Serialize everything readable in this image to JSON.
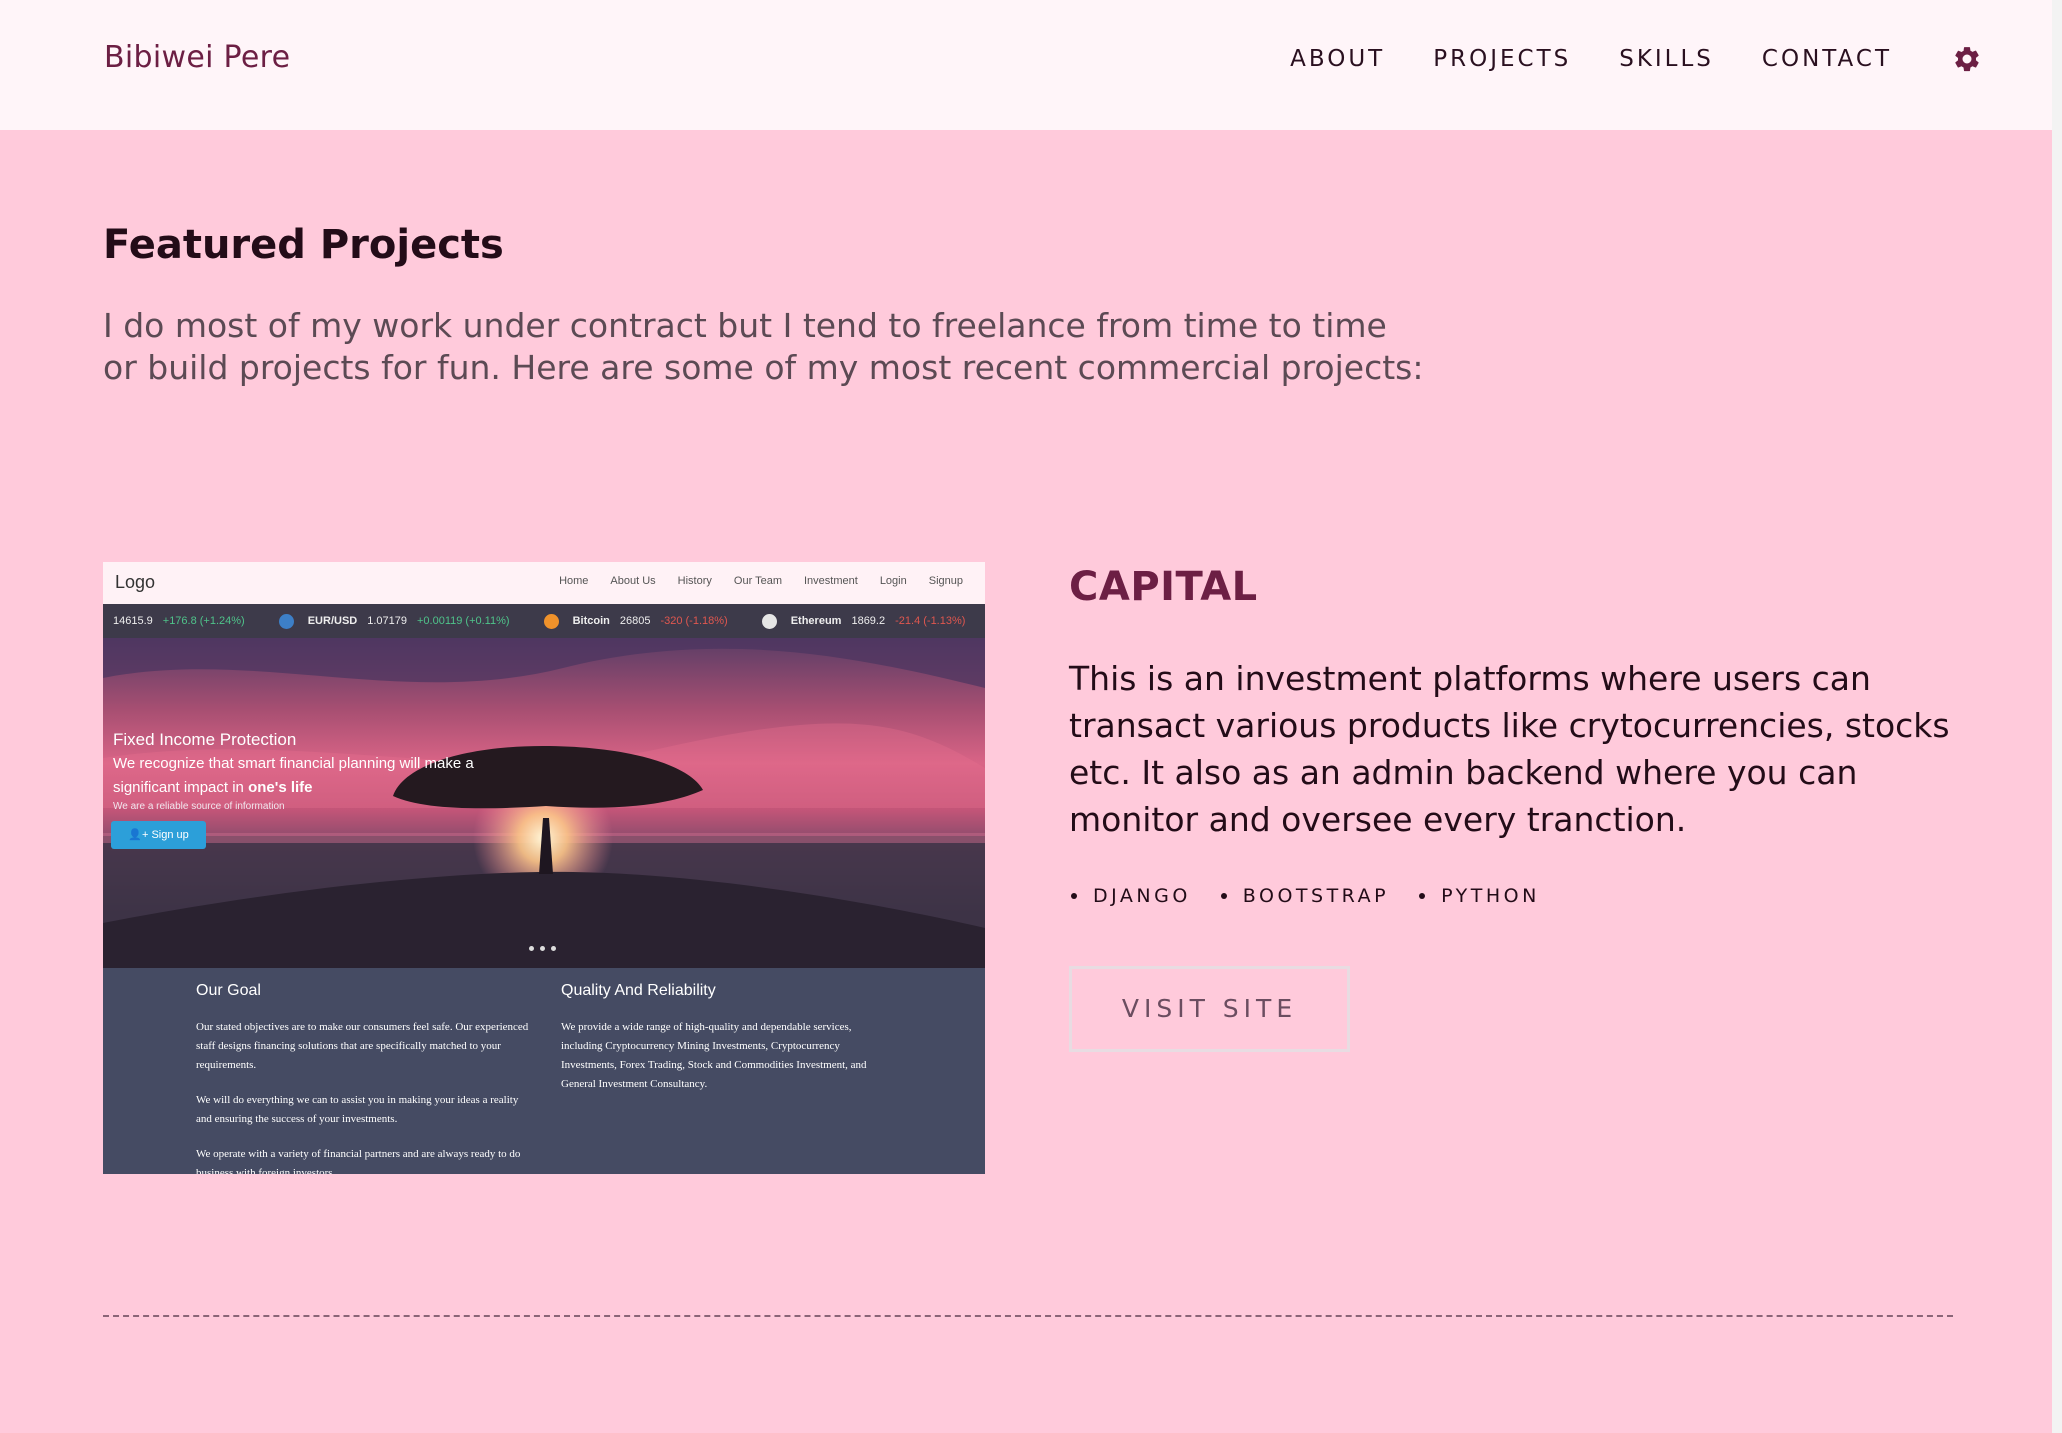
{
  "nav": {
    "brand": "Bibiwei Pere",
    "links": [
      {
        "label": "ABOUT"
      },
      {
        "label": "PROJECTS"
      },
      {
        "label": "SKILLS"
      },
      {
        "label": "CONTACT"
      }
    ],
    "settings_icon": "gear-icon"
  },
  "featured": {
    "heading": "Featured Projects",
    "intro_line1": "I do most of my work under contract but I tend to freelance from time to time",
    "intro_line2": "or build projects for fun. Here are some of my most recent commercial projects:"
  },
  "project": {
    "title": "CAPITAL",
    "description": "This is an investment platforms where users can transact various products like crytocurrencies, stocks etc. It also as an admin backend where you can monitor and oversee every tranction.",
    "tags": [
      "DJANGO",
      "BOOTSTRAP",
      "PYTHON"
    ],
    "visit_label": "VISIT SITE",
    "screenshot": {
      "logo": "Logo",
      "nav_links": [
        "Home",
        "About Us",
        "History",
        "Our Team",
        "Investment",
        "Login",
        "Signup"
      ],
      "ticker": [
        {
          "name": "",
          "price": "14615.9",
          "change": "+176.8 (+1.24%)",
          "direction": "up"
        },
        {
          "name": "EUR/USD",
          "price": "1.07179",
          "change": "+0.00119 (+0.11%)",
          "direction": "up",
          "icon_color": "#3d7fc7"
        },
        {
          "name": "Bitcoin",
          "price": "26805",
          "change": "-320 (-1.18%)",
          "direction": "down",
          "icon_color": "#f0922b"
        },
        {
          "name": "Ethereum",
          "price": "1869.2",
          "change": "-21.4 (-1.13%)",
          "direction": "down",
          "icon_color": "#e6e6e6"
        }
      ],
      "hero_title": "Fixed Income Protection",
      "hero_text": "We recognize that smart financial planning will make a significant impact in",
      "hero_text_bold": "one's life",
      "hero_small": "We are a reliable source of information",
      "signup_label": "Sign up",
      "goal_title": "Our Goal",
      "goal_paragraphs": [
        "Our stated objectives are to make our consumers feel safe. Our experienced staff designs financing solutions that are specifically matched to your requirements.",
        "We will do everything we can to assist you in making your ideas a reality and ensuring the success of your investments.",
        "We operate with a variety of financial partners and are always ready to do business with foreign investors."
      ],
      "quality_title": "Quality And Reliability",
      "quality_paragraph": "We provide a wide range of high-quality and dependable services, including Cryptocurrency Mining Investments, Cryptocurrency Investments, Forex Trading, Stock and Commodities Investment, and General Investment Consultancy."
    }
  },
  "colors": {
    "page_background": "#ffcadb",
    "nav_background": "#fff5f9",
    "accent": "#6c1f44",
    "text": "#230c18"
  }
}
